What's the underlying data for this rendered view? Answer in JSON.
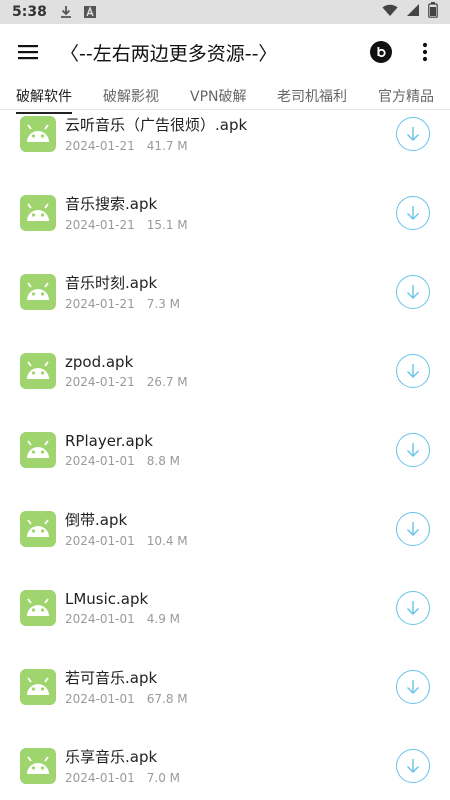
{
  "status_bar": {
    "time": "5:38",
    "icons": [
      "download-icon",
      "font-icon"
    ],
    "right_icons": [
      "wifi-icon",
      "signal-icon",
      "battery-icon"
    ]
  },
  "app_bar": {
    "title": "〈--左右两边更多资源--〉",
    "menu_icon": "menu-icon",
    "actions": [
      "beats-icon",
      "more-vert-icon"
    ]
  },
  "tabs": [
    {
      "label": "破解软件",
      "active": true
    },
    {
      "label": "破解影视",
      "active": false
    },
    {
      "label": "VPN破解",
      "active": false
    },
    {
      "label": "老司机福利",
      "active": false
    },
    {
      "label": "官方精品",
      "active": false
    }
  ],
  "items": [
    {
      "name": "云听音乐（广告很烦）.apk",
      "date": "2024-01-21",
      "size": "41.7 M"
    },
    {
      "name": "音乐搜索.apk",
      "date": "2024-01-21",
      "size": "15.1 M"
    },
    {
      "name": "音乐时刻.apk",
      "date": "2024-01-21",
      "size": "7.3 M"
    },
    {
      "name": "zpod.apk",
      "date": "2024-01-21",
      "size": "26.7 M"
    },
    {
      "name": "RPlayer.apk",
      "date": "2024-01-01",
      "size": "8.8 M"
    },
    {
      "name": "倒带.apk",
      "date": "2024-01-01",
      "size": "10.4 M"
    },
    {
      "name": "LMusic.apk",
      "date": "2024-01-01",
      "size": "4.9 M"
    },
    {
      "name": "若可音乐.apk",
      "date": "2024-01-01",
      "size": "67.8 M"
    },
    {
      "name": "乐享音乐.apk",
      "date": "2024-01-01",
      "size": "7.0 M"
    }
  ],
  "colors": {
    "android_icon_bg": "#9fd46f",
    "download_accent": "#66c3ea",
    "status_bar_bg": "#e0e0e0"
  }
}
